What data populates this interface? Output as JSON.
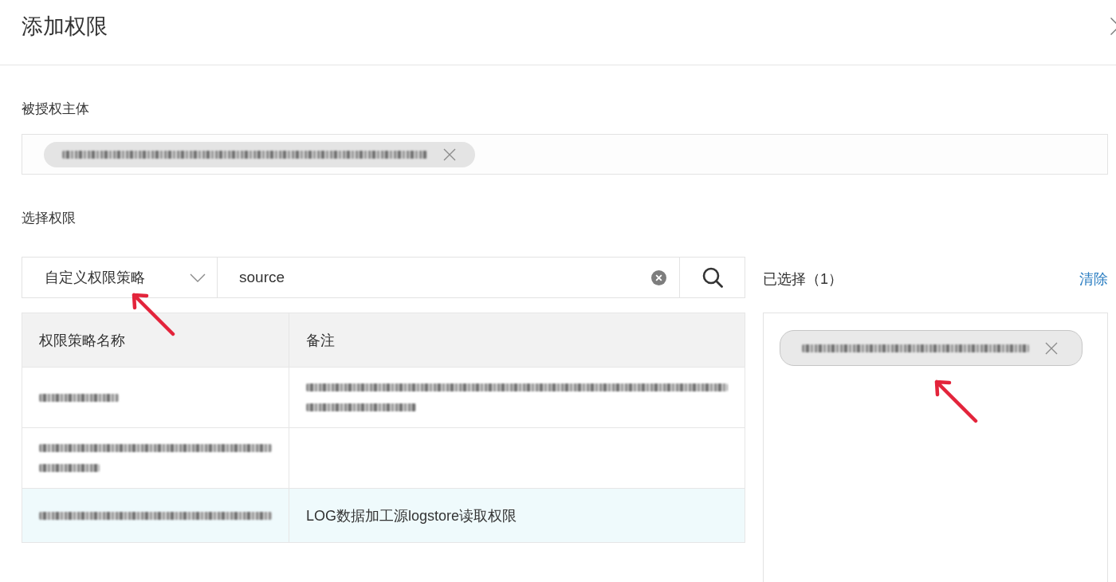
{
  "dialog": {
    "title": "添加权限"
  },
  "principal": {
    "label": "被授权主体",
    "tags": [
      {
        "redacted": true,
        "short": false
      }
    ]
  },
  "permissions": {
    "label": "选择权限",
    "scope_select": {
      "value": "自定义权限策略"
    },
    "search": {
      "value": "source"
    },
    "table": {
      "columns": [
        "权限策略名称",
        "备注"
      ],
      "rows": [
        {
          "selected": false,
          "name": {
            "redacted": true,
            "short": true,
            "multiline": false
          },
          "note": {
            "redacted": true,
            "short": false,
            "multiline": true
          }
        },
        {
          "selected": false,
          "name": {
            "redacted": true,
            "short": false,
            "multiline": true
          }
        },
        {
          "selected": true,
          "name": {
            "redacted": true,
            "short": false,
            "multiline": false
          },
          "note": {
            "text": "LOG数据加工源logstore读取权限"
          }
        }
      ]
    }
  },
  "selection": {
    "title": "已选择（1）",
    "clear": "清除",
    "tags": [
      {
        "redacted": true,
        "short": false
      }
    ]
  }
}
